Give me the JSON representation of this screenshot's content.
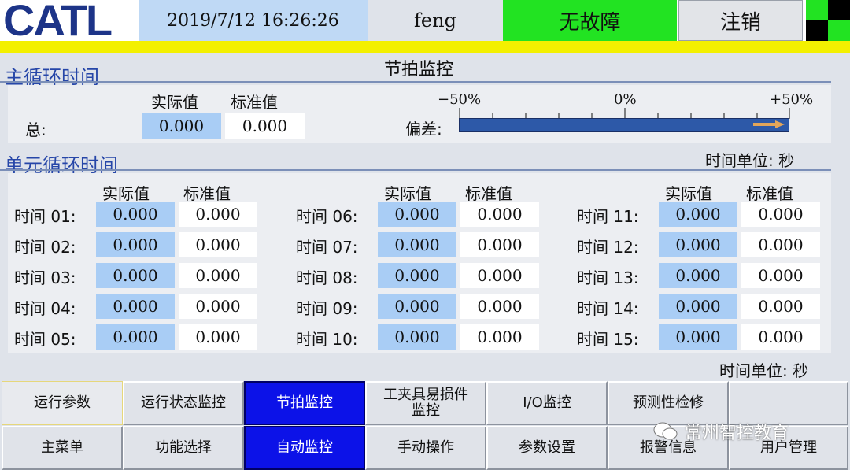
{
  "header": {
    "logo_text": "CATL",
    "datetime": "2019/7/12  16:26:26",
    "user": "feng",
    "status": "无故障",
    "logout_label": "注销",
    "status_color": "#22e322"
  },
  "main_cycle": {
    "section_title": "主循环时间",
    "page_title": "节拍监控",
    "actual_header": "实际值",
    "standard_header": "标准值",
    "total_label": "总:",
    "total_actual": "0.000",
    "total_standard": "0.000",
    "deviation_label": "偏差:",
    "scale_min": "−50%",
    "scale_mid": "0%",
    "scale_max": "+50%"
  },
  "unit_cycle": {
    "section_title": "单元循环时间",
    "unit_top": "时间单位: 秒",
    "unit_bottom": "时间单位: 秒",
    "actual_header": "实际值",
    "standard_header": "标准值",
    "columns": [
      [
        {
          "label": "时间 01:",
          "actual": "0.000",
          "standard": "0.000"
        },
        {
          "label": "时间 02:",
          "actual": "0.000",
          "standard": "0.000"
        },
        {
          "label": "时间 03:",
          "actual": "0.000",
          "standard": "0.000"
        },
        {
          "label": "时间 04:",
          "actual": "0.000",
          "standard": "0.000"
        },
        {
          "label": "时间 05:",
          "actual": "0.000",
          "standard": "0.000"
        }
      ],
      [
        {
          "label": "时间 06:",
          "actual": "0.000",
          "standard": "0.000"
        },
        {
          "label": "时间 07:",
          "actual": "0.000",
          "standard": "0.000"
        },
        {
          "label": "时间 08:",
          "actual": "0.000",
          "standard": "0.000"
        },
        {
          "label": "时间 09:",
          "actual": "0.000",
          "standard": "0.000"
        },
        {
          "label": "时间 10:",
          "actual": "0.000",
          "standard": "0.000"
        }
      ],
      [
        {
          "label": "时间 11:",
          "actual": "0.000",
          "standard": "0.000"
        },
        {
          "label": "时间 12:",
          "actual": "0.000",
          "standard": "0.000"
        },
        {
          "label": "时间 13:",
          "actual": "0.000",
          "standard": "0.000"
        },
        {
          "label": "时间 14:",
          "actual": "0.000",
          "standard": "0.000"
        },
        {
          "label": "时间 15:",
          "actual": "0.000",
          "standard": "0.000"
        }
      ]
    ]
  },
  "nav_row1": [
    "运行参数",
    "运行状态监控",
    "节拍监控",
    "工夹具易损件\n监控",
    "I/O监控",
    "预测性检修",
    ""
  ],
  "nav_row2": [
    "主菜单",
    "功能选择",
    "自动监控",
    "手动操作",
    "参数设置",
    "报警信息",
    "用户管理"
  ],
  "watermark": "常州智控教育",
  "colors": {
    "actual_bg": "#a9cdf5",
    "selected_button": "#0c12e8",
    "yellow_strip": "#f3f000",
    "logo": "#1d3488"
  }
}
